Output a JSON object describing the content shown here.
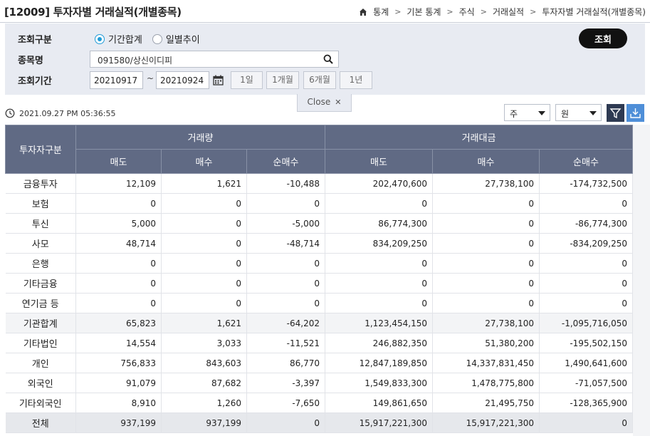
{
  "header": {
    "title": "[12009] 투자자별 거래실적(개별종목)",
    "breadcrumb": [
      "통계",
      "기본 통계",
      "주식",
      "거래실적",
      "투자자별 거래실적(개별종목)"
    ]
  },
  "search": {
    "type_label": "조회구분",
    "radio_options": [
      "기간합계",
      "일별추이"
    ],
    "selected_option": "기간합계",
    "stock_label": "종목명",
    "stock_value": "091580/상신이디피",
    "period_label": "조회기간",
    "start_date": "20210917",
    "end_date": "20210924",
    "tilde": "~",
    "quick_periods": [
      "1일",
      "1개월",
      "6개월",
      "1년"
    ],
    "query_button": "조회",
    "close_label": "Close"
  },
  "toolbar": {
    "timestamp": "2021.09.27 PM 05:36:55",
    "unit_period": "주",
    "unit_currency": "원"
  },
  "table": {
    "investor_header": "투자자구분",
    "groups": [
      "거래량",
      "거래대금"
    ],
    "subcolumns": [
      "매도",
      "매수",
      "순매수",
      "매도",
      "매수",
      "순매수"
    ],
    "rows": [
      {
        "label": "금융투자",
        "cells": [
          "12,109",
          "1,621",
          "-10,488",
          "202,470,600",
          "27,738,100",
          "-174,732,500"
        ]
      },
      {
        "label": "보험",
        "cells": [
          "0",
          "0",
          "0",
          "0",
          "0",
          "0"
        ]
      },
      {
        "label": "투신",
        "cells": [
          "5,000",
          "0",
          "-5,000",
          "86,774,300",
          "0",
          "-86,774,300"
        ]
      },
      {
        "label": "사모",
        "cells": [
          "48,714",
          "0",
          "-48,714",
          "834,209,250",
          "0",
          "-834,209,250"
        ]
      },
      {
        "label": "은행",
        "cells": [
          "0",
          "0",
          "0",
          "0",
          "0",
          "0"
        ]
      },
      {
        "label": "기타금융",
        "cells": [
          "0",
          "0",
          "0",
          "0",
          "0",
          "0"
        ]
      },
      {
        "label": "연기금 등",
        "cells": [
          "0",
          "0",
          "0",
          "0",
          "0",
          "0"
        ]
      },
      {
        "label": "기관합계",
        "cells": [
          "65,823",
          "1,621",
          "-64,202",
          "1,123,454,150",
          "27,738,100",
          "-1,095,716,050"
        ]
      },
      {
        "label": "기타법인",
        "cells": [
          "14,554",
          "3,033",
          "-11,521",
          "246,882,350",
          "51,380,200",
          "-195,502,150"
        ]
      },
      {
        "label": "개인",
        "cells": [
          "756,833",
          "843,603",
          "86,770",
          "12,847,189,850",
          "14,337,831,450",
          "1,490,641,600"
        ]
      },
      {
        "label": "외국인",
        "cells": [
          "91,079",
          "87,682",
          "-3,397",
          "1,549,833,300",
          "1,478,775,800",
          "-71,057,500"
        ]
      },
      {
        "label": "기타외국인",
        "cells": [
          "8,910",
          "1,260",
          "-7,650",
          "149,861,650",
          "21,495,750",
          "-128,365,900"
        ]
      },
      {
        "label": "전체",
        "cells": [
          "937,199",
          "937,199",
          "0",
          "15,917,221,300",
          "15,917,221,300",
          "0"
        ]
      }
    ]
  }
}
